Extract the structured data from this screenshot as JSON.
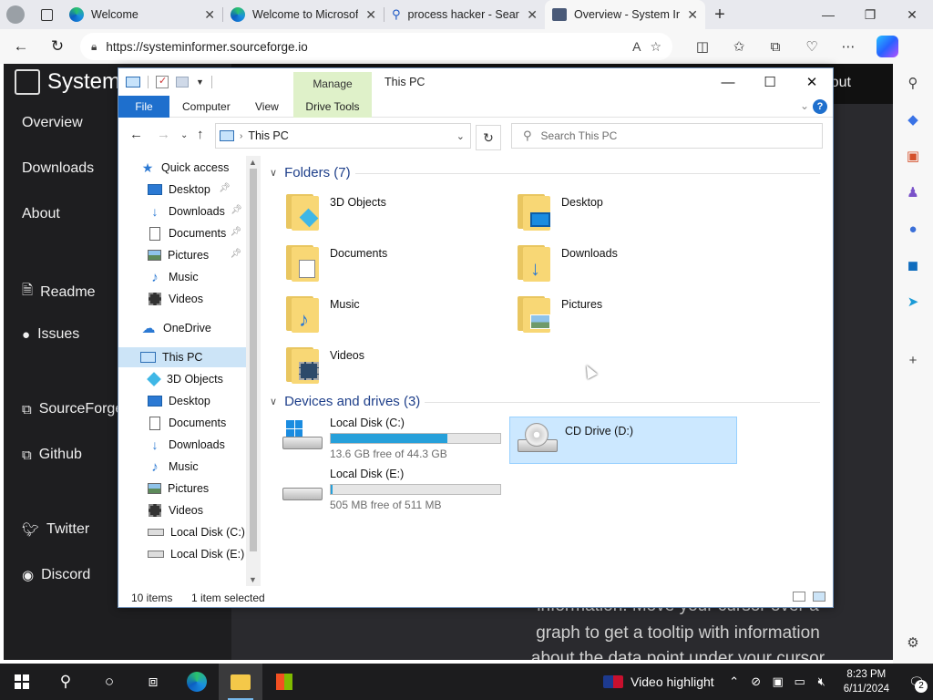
{
  "browser": {
    "tabs": [
      {
        "title": "Welcome"
      },
      {
        "title": "Welcome to Microsoft"
      },
      {
        "title": "process hacker - Search"
      },
      {
        "title": "Overview - System Informer"
      }
    ],
    "url": "https://systeminformer.sourceforge.io"
  },
  "site": {
    "brand": "System",
    "nav": [
      {
        "label": "Overview"
      },
      {
        "label": "Downloads"
      },
      {
        "label": "About"
      },
      {
        "label": "Readme"
      },
      {
        "label": "Issues"
      },
      {
        "label": "SourceForge"
      },
      {
        "label": "Github"
      },
      {
        "label": "Twitter"
      },
      {
        "label": "Discord"
      }
    ],
    "topbar_about": "out",
    "body_lines": [
      "information. Move your cursor over a",
      "graph to get a tooltip with information",
      "about the data point under your cursor"
    ]
  },
  "explorer": {
    "title": "This PC",
    "manage_tab": "Manage",
    "ribbon": {
      "file": "File",
      "computer": "Computer",
      "view": "View",
      "drive_tools": "Drive Tools"
    },
    "path": "This PC",
    "search_placeholder": "Search This PC",
    "nav_pane": [
      {
        "label": "Quick access"
      },
      {
        "label": "Desktop"
      },
      {
        "label": "Downloads"
      },
      {
        "label": "Documents"
      },
      {
        "label": "Pictures"
      },
      {
        "label": "Music"
      },
      {
        "label": "Videos"
      },
      {
        "label": "OneDrive"
      },
      {
        "label": "This PC"
      },
      {
        "label": "3D Objects"
      },
      {
        "label": "Desktop"
      },
      {
        "label": "Documents"
      },
      {
        "label": "Downloads"
      },
      {
        "label": "Music"
      },
      {
        "label": "Pictures"
      },
      {
        "label": "Videos"
      },
      {
        "label": "Local Disk (C:)"
      },
      {
        "label": "Local Disk (E:)"
      }
    ],
    "folders_header": "Folders (7)",
    "folders": [
      {
        "name": "3D Objects"
      },
      {
        "name": "Desktop"
      },
      {
        "name": "Documents"
      },
      {
        "name": "Downloads"
      },
      {
        "name": "Music"
      },
      {
        "name": "Pictures"
      },
      {
        "name": "Videos"
      }
    ],
    "devices_header": "Devices and drives (3)",
    "drives": [
      {
        "name": "Local Disk (C:)",
        "free": "13.6 GB free of 44.3 GB",
        "used_fraction": 0.69
      },
      {
        "name": "CD Drive (D:)"
      },
      {
        "name": "Local Disk (E:)",
        "free": "505 MB free of 511 MB",
        "used_fraction": 0.01
      }
    ],
    "status": {
      "items": "10 items",
      "selected": "1 item selected"
    }
  },
  "taskbar": {
    "video_highlight": "Video highlight",
    "time": "8:23 PM",
    "date": "6/11/2024",
    "notifications": "2"
  },
  "colors": {
    "accent": "#1e6fcd",
    "selection": "#cce8ff",
    "drive_fill": "#26a0da",
    "manage_green": "#dff1c9"
  }
}
